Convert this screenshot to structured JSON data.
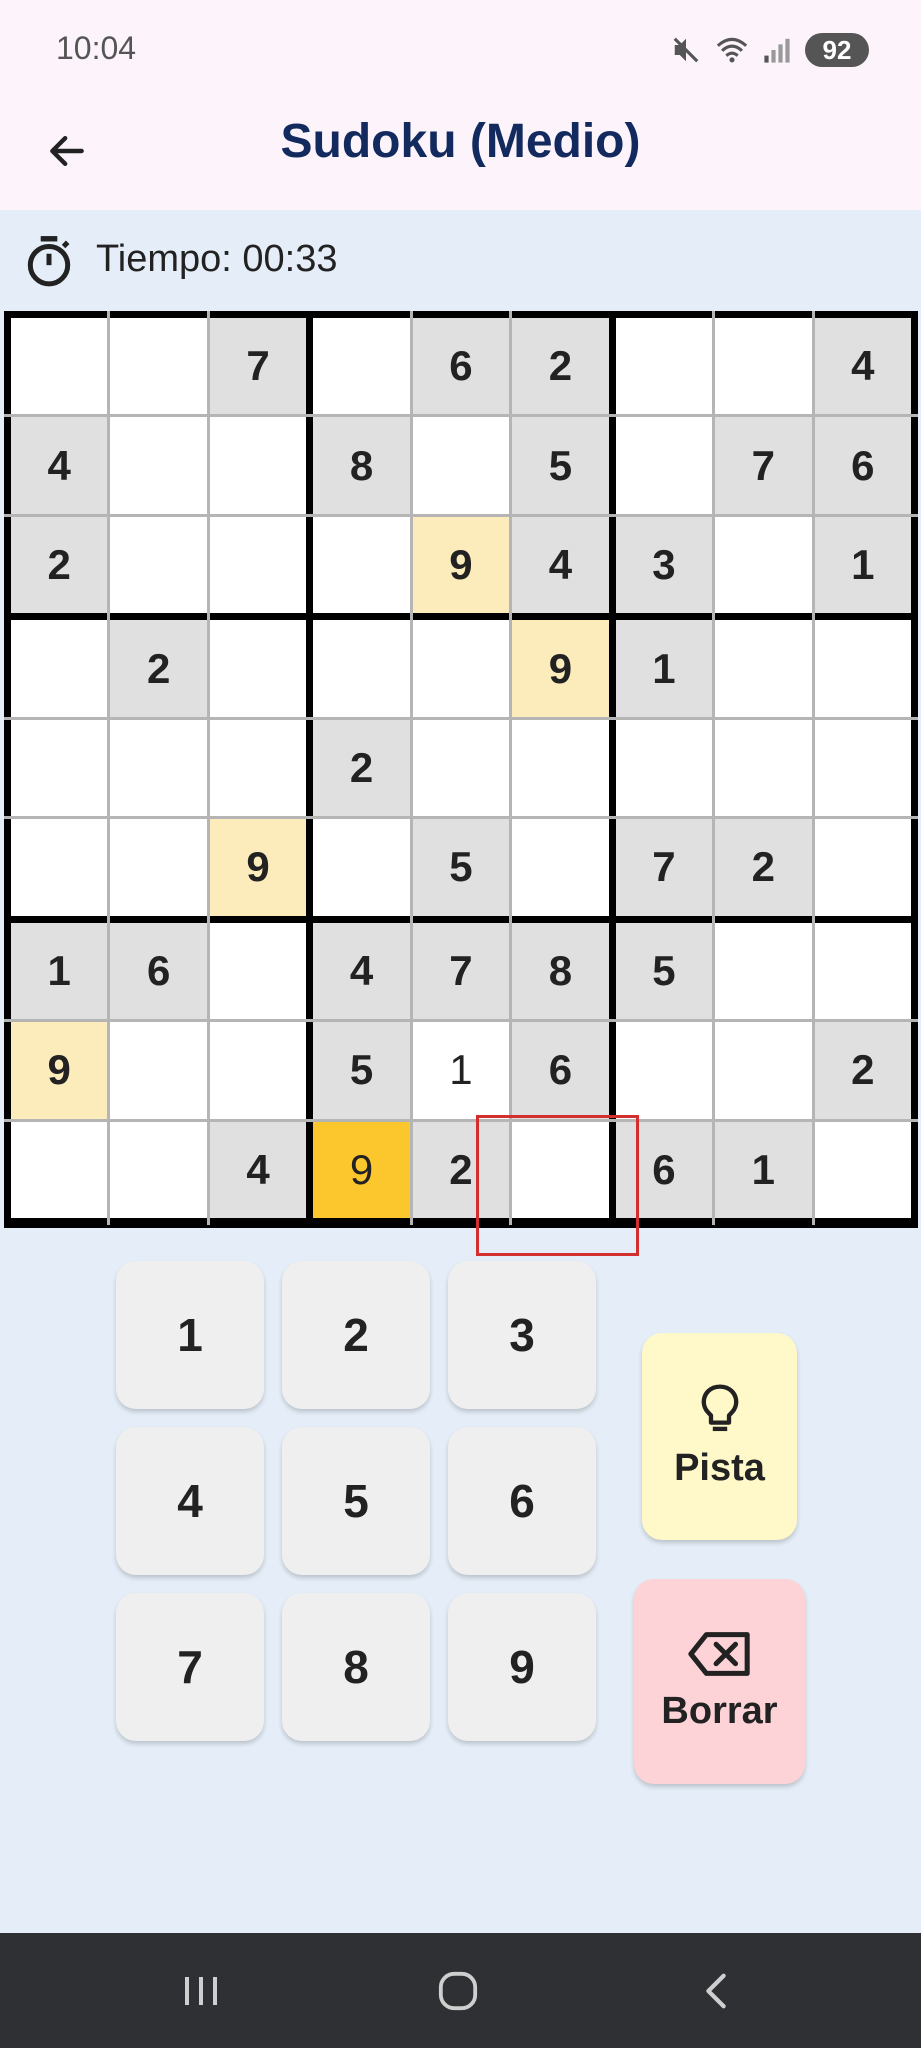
{
  "status_bar": {
    "time": "10:04",
    "battery": "92"
  },
  "header": {
    "title": "Sudoku (Medio)"
  },
  "timer": {
    "text": "Tiempo: 00:33"
  },
  "board": {
    "rows": [
      [
        "",
        "",
        "7",
        "",
        "6",
        "2",
        "",
        "",
        "4"
      ],
      [
        "4",
        "",
        "",
        "8",
        "",
        "5",
        "",
        "7",
        "6"
      ],
      [
        "2",
        "",
        "",
        "",
        "9",
        "4",
        "3",
        "",
        "1"
      ],
      [
        "",
        "2",
        "",
        "",
        "",
        "9",
        "1",
        "",
        ""
      ],
      [
        "",
        "",
        "",
        "2",
        "",
        "",
        "",
        "",
        ""
      ],
      [
        "",
        "",
        "9",
        "",
        "5",
        "",
        "7",
        "2",
        ""
      ],
      [
        "1",
        "6",
        "",
        "4",
        "7",
        "8",
        "5",
        "",
        ""
      ],
      [
        "9",
        "",
        "",
        "5",
        "1",
        "6",
        "",
        "",
        "2"
      ],
      [
        "",
        "",
        "4",
        "9",
        "2",
        "",
        "6",
        "1",
        ""
      ]
    ],
    "highlight_color": "#fdecbb",
    "selected_color": "#fcc62d"
  },
  "keypad": {
    "keys": [
      "1",
      "2",
      "3",
      "4",
      "5",
      "6",
      "7",
      "8",
      "9"
    ]
  },
  "actions": {
    "hint_label": "Pista",
    "hint_icon": "lightbulb-icon",
    "erase_label": "Borrar",
    "erase_icon": "backspace-icon"
  },
  "nav": {
    "icons": [
      "recent-apps-icon",
      "home-icon",
      "back-icon"
    ]
  }
}
